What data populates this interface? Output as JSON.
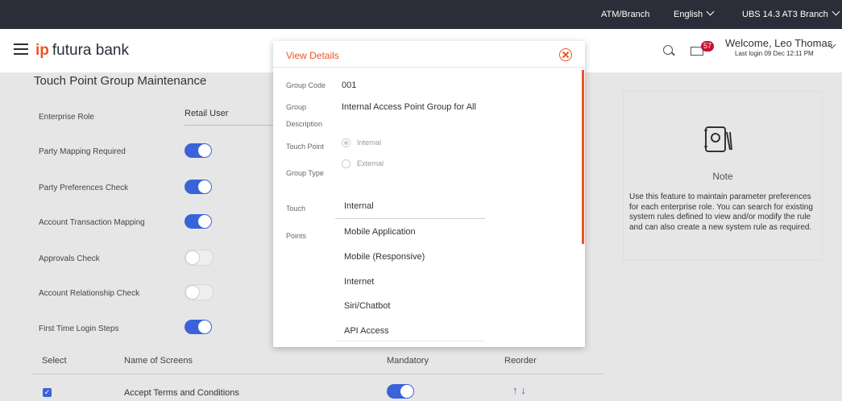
{
  "topbar": {
    "atm_branch": "ATM/Branch",
    "language": "English",
    "branch": "UBS 14.3 AT3 Branch"
  },
  "header": {
    "brand": "futura bank",
    "brand_mark": "ip",
    "notification_count": "57",
    "welcome": "Welcome, Leo Thomas",
    "last_login": "Last login 09 Dec 12:11 PM"
  },
  "page": {
    "title": "Touch Point Group Maintenance"
  },
  "form": {
    "enterprise_role_label": "Enterprise Role",
    "enterprise_role_value": "Retail User",
    "toggles": [
      {
        "label": "Party Mapping Required",
        "on": true
      },
      {
        "label": "Party Preferences Check",
        "on": true
      },
      {
        "label": "Account Transaction Mapping",
        "on": true
      },
      {
        "label": "Approvals Check",
        "on": false
      },
      {
        "label": "Account Relationship Check",
        "on": false
      },
      {
        "label": "First Time Login Steps",
        "on": true
      }
    ]
  },
  "table": {
    "headers": {
      "select": "Select",
      "name": "Name of Screens",
      "mandatory": "Mandatory",
      "reorder": "Reorder"
    },
    "rows": [
      {
        "name": "Accept Terms and Conditions",
        "checked": true,
        "mandatory": true,
        "reorder": "↑ ↓"
      }
    ]
  },
  "note": {
    "title": "Note",
    "text": "Use this feature to maintain parameter preferences for each enterprise role. You can search for existing system rules defined to view and/or modify the rule and can also create a new system rule as required."
  },
  "modal": {
    "title": "View Details",
    "group_code_label": "Group Code",
    "group_code": "001",
    "group_desc_label_1": "Group",
    "group_desc_label_2": "Description",
    "group_desc": "Internal Access Point Group for All",
    "tp_type_label_1": "Touch Point",
    "tp_type_label_2": "Group Type",
    "tp_type_options": [
      "Internal",
      "External"
    ],
    "tp_type_selected": "Internal",
    "touch_points_label_1": "Touch",
    "touch_points_label_2": "Points",
    "touch_points": [
      "Internal",
      "Mobile Application",
      "Mobile (Responsive)",
      "Internet",
      "Siri/Chatbot",
      "API Access"
    ]
  },
  "colors": {
    "accent": "#e8562a",
    "toggle_on": "#3a63d9",
    "topbar": "#2b2d38",
    "badge": "#c8102e"
  }
}
